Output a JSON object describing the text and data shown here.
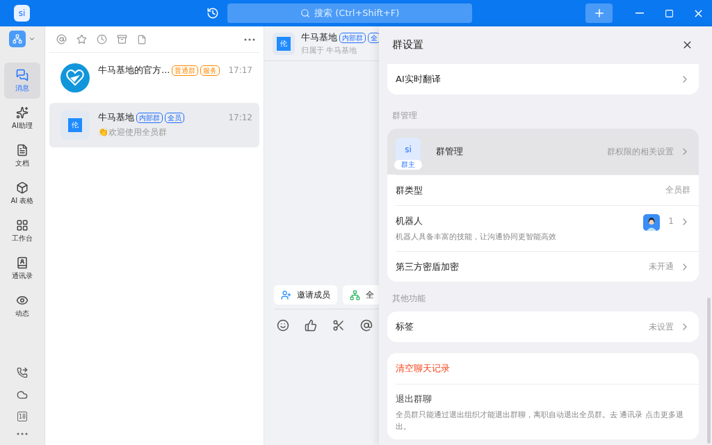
{
  "title_bar": {
    "logo": "si",
    "search": {
      "placeholder": "搜索 (Ctrl+Shift+F)"
    }
  },
  "rail": {
    "items": [
      {
        "label": "消息",
        "selected": true
      },
      {
        "label": "AI助理",
        "selected": false
      },
      {
        "label": "文档",
        "selected": false
      },
      {
        "label": "AI 表格",
        "selected": false
      },
      {
        "label": "工作台",
        "selected": false
      },
      {
        "label": "通讯录",
        "selected": false
      },
      {
        "label": "动态",
        "selected": false
      }
    ],
    "bottom": {
      "calendar_day": "18"
    }
  },
  "chat_list": {
    "items": [
      {
        "name": "牛马基地的官方...",
        "kind": "logo",
        "tags": [
          {
            "label": "普通群",
            "color": "#ff8a00"
          },
          {
            "label": "服务",
            "color": "#ff8a00"
          }
        ],
        "time": "17:17",
        "selected": false
      },
      {
        "name": "牛马基地",
        "kind": "initial",
        "avatar": "伦",
        "tags": [
          {
            "label": "内部群",
            "color": "#1f6fff"
          },
          {
            "label": "全员",
            "color": "#1f6fff"
          }
        ],
        "time": "17:12",
        "preview": "👏欢迎使用全员群",
        "selected": true
      }
    ]
  },
  "chat": {
    "avatar": "伦",
    "name": "牛马基地",
    "tags": [
      "内部群",
      "全"
    ],
    "subtitle": "归属于 牛马基地",
    "quick_actions": [
      {
        "label": "邀请成员"
      },
      {
        "label": "全"
      }
    ]
  },
  "drawer": {
    "title": "群设置",
    "sections": [
      {
        "rows": [
          {
            "kind": "plain",
            "label": "AI实时翻译",
            "chevron": true
          }
        ]
      },
      {
        "heading": "群管理",
        "rows": [
          {
            "kind": "admin",
            "avatar": "si",
            "badge": "群主",
            "label": "群管理",
            "value": "群权限的相关设置",
            "chevron": true,
            "highlighted": true
          },
          {
            "kind": "plain",
            "label": "群类型",
            "value": "全员群",
            "chevron": false
          },
          {
            "kind": "robot",
            "label": "机器人",
            "value": "1",
            "description": "机器人具备丰富的技能，让沟通协同更智能高效",
            "chevron": true
          },
          {
            "kind": "plain",
            "label": "第三方密盾加密",
            "value": "未开通",
            "chevron": true
          }
        ]
      },
      {
        "heading": "其他功能",
        "rows": [
          {
            "kind": "plain",
            "label": "标签",
            "value": "未设置",
            "chevron": true
          }
        ]
      },
      {
        "rows": [
          {
            "kind": "danger",
            "label": "清空聊天记录"
          },
          {
            "kind": "note",
            "label": "退出群聊",
            "description": "全员群只能通过退出组织才能退出群聊，离职自动退出全员群。去 通讯录 点击更多退出。"
          }
        ]
      }
    ]
  }
}
